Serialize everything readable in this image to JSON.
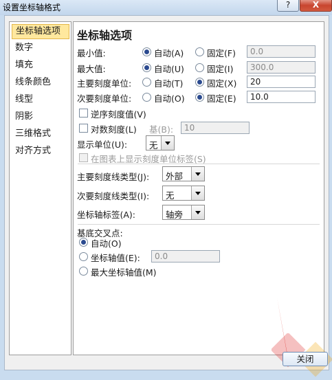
{
  "window": {
    "title": "设置坐标轴格式",
    "help_label": "?",
    "close_label": "X"
  },
  "sidebar": {
    "items": [
      {
        "label": "坐标轴选项",
        "selected": true
      },
      {
        "label": "数字"
      },
      {
        "label": "填充"
      },
      {
        "label": "线条颜色"
      },
      {
        "label": "线型"
      },
      {
        "label": "阴影"
      },
      {
        "label": "三维格式"
      },
      {
        "label": "对齐方式"
      }
    ]
  },
  "panel": {
    "heading": "坐标轴选项",
    "rows": [
      {
        "label": "最小值:",
        "auto": "自动(A)",
        "fixed": "固定(F)",
        "value": "0.0",
        "selected": "auto"
      },
      {
        "label": "最大值:",
        "auto": "自动(U)",
        "fixed": "固定(I)",
        "value": "300.0",
        "selected": "auto"
      },
      {
        "label": "主要刻度单位:",
        "auto": "自动(T)",
        "fixed": "固定(X)",
        "value": "20",
        "selected": "fixed"
      },
      {
        "label": "次要刻度单位:",
        "auto": "自动(O)",
        "fixed": "固定(E)",
        "value": "10.0",
        "selected": "fixed"
      }
    ],
    "reverse_label": "逆序刻度值(V)",
    "log_label": "对数刻度(L)",
    "base_label": "基(B):",
    "base_value": "10",
    "display_unit_label": "显示单位(U):",
    "display_unit_value": "无",
    "show_unit_label": "在图表上显示刻度单位标签(S)",
    "major_tick_label": "主要刻度线类型(J):",
    "major_tick_value": "外部",
    "minor_tick_label": "次要刻度线类型(I):",
    "minor_tick_value": "无",
    "axis_label_label": "坐标轴标签(A):",
    "axis_label_value": "轴旁",
    "cross_heading": "基底交叉点:",
    "cross_auto": "自动(O)",
    "cross_value_label": "坐标轴值(E):",
    "cross_value": "0.0",
    "cross_max": "最大坐标轴值(M)"
  },
  "footer": {
    "close_label": "关闭"
  }
}
